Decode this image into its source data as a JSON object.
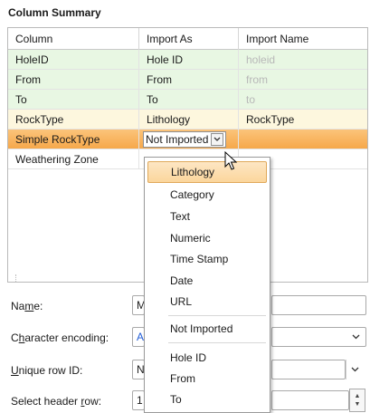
{
  "panel": {
    "title": "Column Summary"
  },
  "table": {
    "headers": [
      "Column",
      "Import As",
      "Import Name"
    ],
    "rows": [
      {
        "column": "HoleID",
        "import_as": "Hole ID",
        "import_name": "holeid"
      },
      {
        "column": "From",
        "import_as": "From",
        "import_name": "from"
      },
      {
        "column": "To",
        "import_as": "To",
        "import_name": "to"
      },
      {
        "column": "RockType",
        "import_as": "Lithology",
        "import_name": "RockType"
      },
      {
        "column": "Simple RockType",
        "import_as": "Not Imported",
        "import_name": ""
      },
      {
        "column": "Weathering Zone",
        "import_as": "",
        "import_name": ""
      }
    ],
    "row_colors": {
      "mapped": "#e8f7e3",
      "user": "#fdf7de",
      "selected": "#f8b35f"
    }
  },
  "form": {
    "name_label": "Name:",
    "name_value": "M",
    "encoding_label": "Character encoding:",
    "encoding_value": "A",
    "unique_label": "Unique row ID:",
    "unique_value": "N",
    "header_row_label": "Select header row:",
    "header_row_value": "1"
  },
  "dropdown": {
    "items": [
      "Lithology",
      "Category",
      "Text",
      "Numeric",
      "Time Stamp",
      "Date",
      "URL",
      "Not Imported",
      "Hole ID",
      "From",
      "To"
    ],
    "selected": "Lithology"
  },
  "icons": {
    "dropdown": "chevron-down-icon",
    "cursor": "mouse-pointer-icon",
    "spinner": "spinner-arrows-icon"
  }
}
